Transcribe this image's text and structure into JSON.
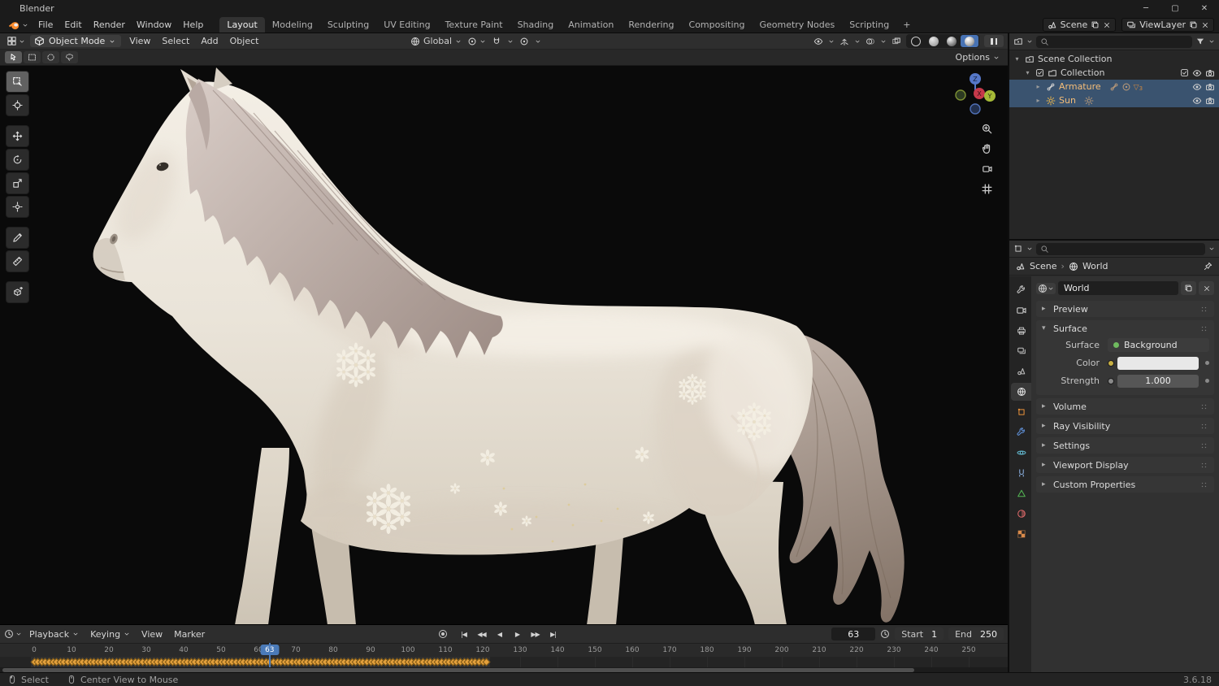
{
  "window": {
    "title": "Blender",
    "controls": {
      "minimize": "─",
      "maximize": "▢",
      "close": "✕"
    }
  },
  "menubar": {
    "menus": [
      "File",
      "Edit",
      "Render",
      "Window",
      "Help"
    ],
    "workspaces": [
      "Layout",
      "Modeling",
      "Sculpting",
      "UV Editing",
      "Texture Paint",
      "Shading",
      "Animation",
      "Rendering",
      "Compositing",
      "Geometry Nodes",
      "Scripting"
    ],
    "active_workspace": "Layout",
    "add_workspace": "+",
    "scene": {
      "label": "Scene"
    },
    "viewlayer": {
      "label": "ViewLayer"
    }
  },
  "viewport": {
    "header": {
      "mode": "Object Mode",
      "menus": [
        "View",
        "Select",
        "Add",
        "Object"
      ],
      "orientation": "Global",
      "options": "Options"
    },
    "gizmo": {
      "x": "X",
      "y": "Y",
      "z": "Z"
    },
    "tools": [
      {
        "name": "select-box-tool",
        "icon": "t_select",
        "active": true
      },
      {
        "name": "cursor-tool",
        "icon": "t_cursor"
      },
      {
        "name": "move-tool",
        "icon": "t_move",
        "group_start": true
      },
      {
        "name": "rotate-tool",
        "icon": "t_rotate"
      },
      {
        "name": "scale-tool",
        "icon": "t_scale"
      },
      {
        "name": "transform-tool",
        "icon": "t_transform"
      },
      {
        "name": "annotate-tool",
        "icon": "t_annotate",
        "group_start": true
      },
      {
        "name": "measure-tool",
        "icon": "t_measure"
      },
      {
        "name": "add-cube-tool",
        "icon": "t_addcube",
        "group_start": true
      }
    ]
  },
  "outliner": {
    "rows": [
      {
        "label": "Scene Collection",
        "indent": 0,
        "arrow": "▾",
        "icon": "scenecol",
        "selected": false,
        "pre": [],
        "extras": [],
        "right": []
      },
      {
        "label": "Collection",
        "indent": 1,
        "arrow": "▾",
        "icon": "collection",
        "selected": false,
        "pre": [
          "checkbox"
        ],
        "extras": [],
        "right": [
          "checkbox",
          "eye",
          "camera"
        ]
      },
      {
        "label": "Armature",
        "indent": 2,
        "arrow": "▸",
        "icon": "bone",
        "selected": true,
        "pre": [],
        "extras": [
          "bone",
          "target"
        ],
        "badge": "3",
        "right": [
          "eye",
          "camera"
        ]
      },
      {
        "label": "Sun",
        "indent": 2,
        "arrow": "▸",
        "icon": "sun",
        "selected": true,
        "pre": [],
        "extras": [
          "sun"
        ],
        "right": [
          "eye",
          "camera"
        ]
      }
    ]
  },
  "properties": {
    "breadcrumb": {
      "scene": "Scene",
      "separator": "›",
      "world": "World"
    },
    "datablock_name": "World",
    "tabs": [
      {
        "name": "tool-tab",
        "icon": "wrench",
        "color": "#c1c1c1",
        "active": false
      },
      {
        "name": "render-tab",
        "icon": "camview",
        "color": "#c1c1c1",
        "active": false
      },
      {
        "name": "output-tab",
        "icon": "printer",
        "color": "#c1c1c1",
        "active": false
      },
      {
        "name": "view-layer-tab",
        "icon": "layers",
        "color": "#c1c1c1",
        "active": false
      },
      {
        "name": "scene-tab",
        "icon": "scene",
        "color": "#c1c1c1",
        "active": false
      },
      {
        "name": "world-tab",
        "icon": "globe",
        "color": "#e4e4e4",
        "active": true
      },
      {
        "name": "object-tab",
        "icon": "objsq",
        "color": "#e8913a",
        "active": false
      },
      {
        "name": "modifiers-tab",
        "icon": "wrench",
        "color": "#5f8fd6",
        "active": false
      },
      {
        "name": "physics-tab",
        "icon": "orbit",
        "color": "#62b6cd",
        "active": false
      },
      {
        "name": "constraints-tab",
        "icon": "constraint",
        "color": "#8fb6e8",
        "active": false
      },
      {
        "name": "data-tab",
        "icon": "tri",
        "color": "#53b553",
        "active": false
      },
      {
        "name": "material-tab",
        "icon": "sphere",
        "color": "#e06a6a",
        "active": false
      },
      {
        "name": "texture-tab",
        "icon": "checker",
        "color": "#d98a4a",
        "active": false
      }
    ],
    "panels_top": [
      {
        "label": "Preview"
      }
    ],
    "surface_panel": {
      "label": "Surface",
      "rows": [
        {
          "label": "Surface",
          "widget": "menu",
          "value": "Background",
          "dot_color": "#6fba5f",
          "anim_dot": false
        },
        {
          "label": "Color",
          "widget": "color",
          "value": "#e8e8e8",
          "socket": "#c9b043",
          "anim_dot": true
        },
        {
          "label": "Strength",
          "widget": "number",
          "value": "1.000",
          "socket": "#8a8a8a",
          "anim_dot": true
        }
      ]
    },
    "panels_bottom": [
      {
        "label": "Volume"
      },
      {
        "label": "Ray Visibility"
      },
      {
        "label": "Settings"
      },
      {
        "label": "Viewport Display"
      },
      {
        "label": "Custom Properties"
      }
    ]
  },
  "timeline": {
    "menus": [
      {
        "label": "Playback",
        "chev": true
      },
      {
        "label": "Keying",
        "chev": true
      },
      {
        "label": "View",
        "chev": false
      },
      {
        "label": "Marker",
        "chev": false
      }
    ],
    "transport": [
      {
        "name": "jump-to-start-button",
        "glyph": "|◀"
      },
      {
        "name": "previous-keyframe-button",
        "glyph": "◀◀"
      },
      {
        "name": "play-reverse-button",
        "glyph": "◀"
      },
      {
        "name": "play-button",
        "glyph": "▶"
      },
      {
        "name": "next-keyframe-button",
        "glyph": "▶▶"
      },
      {
        "name": "jump-to-end-button",
        "glyph": "▶|"
      }
    ],
    "current_frame": 63,
    "start_label": "Start",
    "start_value": "1",
    "end_label": "End",
    "end_value": "250",
    "ruler": {
      "start": 0,
      "end": 250,
      "step": 10
    },
    "keyframes": {
      "from": 0,
      "to": 121
    }
  },
  "statusbar": {
    "hints": [
      {
        "icon": "mouseL",
        "label": "Select"
      },
      {
        "icon": "mouseM",
        "label": "Center View to Mouse"
      }
    ],
    "version": "3.6.18"
  },
  "colors": {
    "accent": "#4772b3",
    "selection": "#3a536f",
    "keyframe": "#e3a03c",
    "active_text": "#f5bd78"
  }
}
